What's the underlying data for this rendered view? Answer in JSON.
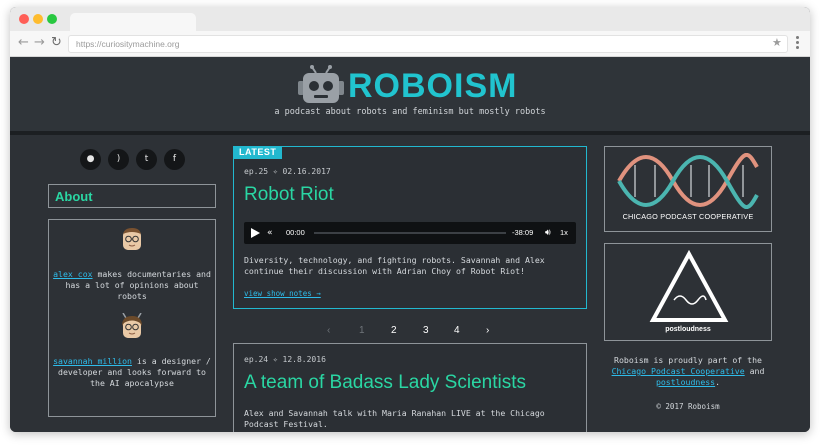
{
  "browser": {
    "url": "https://curiositymachine.org"
  },
  "site": {
    "logo_text": "ROBOISM",
    "tagline": "a podcast about robots and feminism but mostly robots"
  },
  "social_icons": [
    "apple-icon",
    "rss-icon",
    "twitter-icon",
    "facebook-icon"
  ],
  "about": {
    "title": "About",
    "host1": {
      "name": "alex cox",
      "bio": "makes documentaries and has a lot of opinions about robots"
    },
    "host2": {
      "name": "savannah million",
      "bio": "is a designer / developer and looks forward to the AI apocalypse"
    }
  },
  "latest_episode": {
    "badge": "LATEST",
    "meta": "ep.25 ✧ 02.16.2017",
    "title": "Robot Riot",
    "player": {
      "current": "00:00",
      "remaining": "-38:09",
      "speed": "1x",
      "progress": 0
    },
    "description": "Diversity, technology, and fighting robots. Savannah and Alex continue their discussion with Adrian Choy of Robot Riot!",
    "show_notes": "view show notes →"
  },
  "pagination": {
    "prev": "‹",
    "pages": [
      "1",
      "2",
      "3",
      "4"
    ],
    "current": "1",
    "next": "›"
  },
  "second_episode": {
    "meta": "ep.24 ✧ 12.8.2016",
    "title": "A team of Badass Lady Scientists",
    "description": "Alex and Savannah talk with Maria Ranahan LIVE at the Chicago Podcast Festival."
  },
  "sidebar_right": {
    "cpc_label": "CHICAGO PODCAST COOPERATIVE",
    "pl_label": "postloudness",
    "text_pre": "Roboism is proudly part of the",
    "cpc_link": "Chicago Podcast Cooperative",
    "and": "and",
    "pl_link": "postloudness",
    "period": ".",
    "copyright": "© 2017 Roboism"
  },
  "colors": {
    "accent": "#22b8cf",
    "title_green": "#2ad6a3",
    "link": "#2ebcea",
    "bg": "#2d3136"
  }
}
